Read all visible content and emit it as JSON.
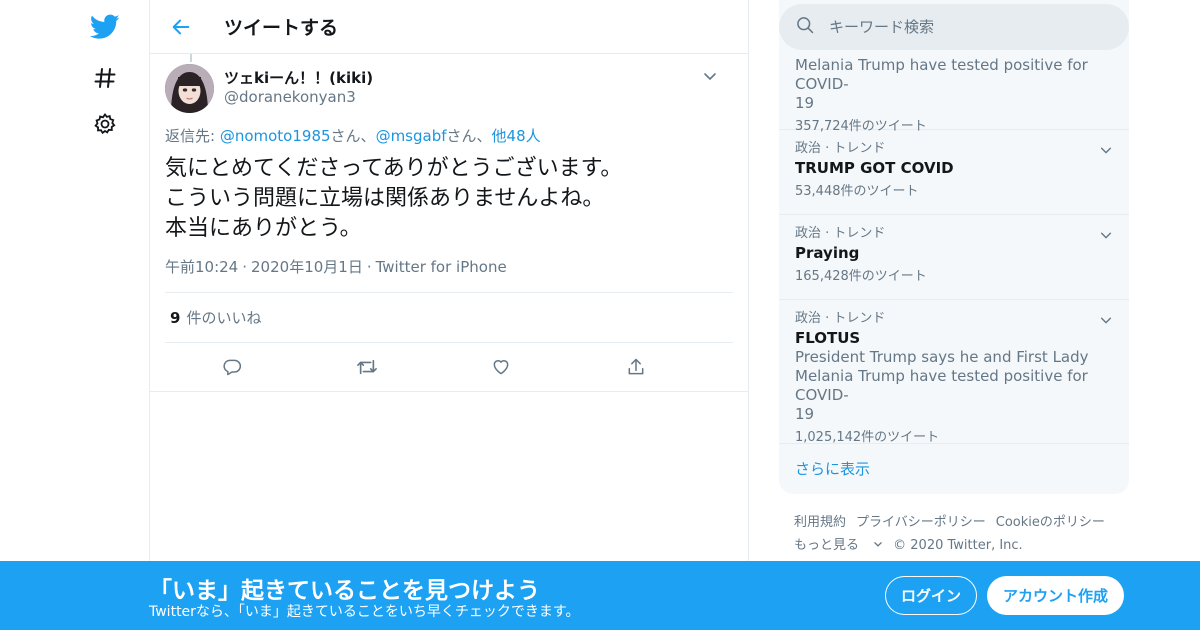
{
  "colors": {
    "accent": "#1da1f2",
    "link": "#1b95e0",
    "muted": "#657786",
    "border": "#e6ecf0"
  },
  "nav": {
    "icons": [
      "twitter-bird-icon",
      "hashtag-icon",
      "gear-icon"
    ]
  },
  "header": {
    "title": "ツイートする"
  },
  "tweet": {
    "author_name": "ツェkiーん！！(kiki)",
    "author_handle": "@doranekonyan3",
    "reply_prefix": "返信先: ",
    "reply_user1": "@nomoto1985",
    "reply_sep1": "さん、",
    "reply_user2": "@msgabf",
    "reply_sep2": "さん、",
    "reply_others": "他48人",
    "text_line1": "気にとめてくださってありがとうございます。",
    "text_line2": "こういう問題に立場は関係ありませんよね。",
    "text_line3": "本当にありがとう。",
    "time": "午前10:24",
    "date": "2020年10月1日",
    "source": "Twitter for iPhone",
    "likes_count": "9",
    "likes_label": "件のいいね"
  },
  "search": {
    "placeholder": "キーワード検索"
  },
  "trends": [
    {
      "partial_desc_line1": "Melania Trump have tested positive for COVID-",
      "partial_desc_line2": "19",
      "count": "357,724件のツイート"
    },
    {
      "meta": "政治 · トレンド",
      "name": "TRUMP GOT COVID",
      "count": "53,448件のツイート"
    },
    {
      "meta": "政治 · トレンド",
      "name": "Praying",
      "count": "165,428件のツイート"
    },
    {
      "meta": "政治 · トレンド",
      "name": "FLOTUS",
      "desc_line1": "President Trump says he and First Lady",
      "desc_line2": "Melania Trump have tested positive for COVID-",
      "desc_line3": "19",
      "count": "1,025,142件のツイート"
    }
  ],
  "show_more": "さらに表示",
  "footer": {
    "links": [
      "利用規約",
      "プライバシーポリシー",
      "Cookieのポリシー"
    ],
    "more": "もっと見る",
    "copyright": "© 2020 Twitter, Inc."
  },
  "banner": {
    "title": "「いま」起きていることを見つけよう",
    "subtitle": "Twitterなら、「いま」起きていることをいち早くチェックできます。",
    "login": "ログイン",
    "signup": "アカウント作成"
  }
}
